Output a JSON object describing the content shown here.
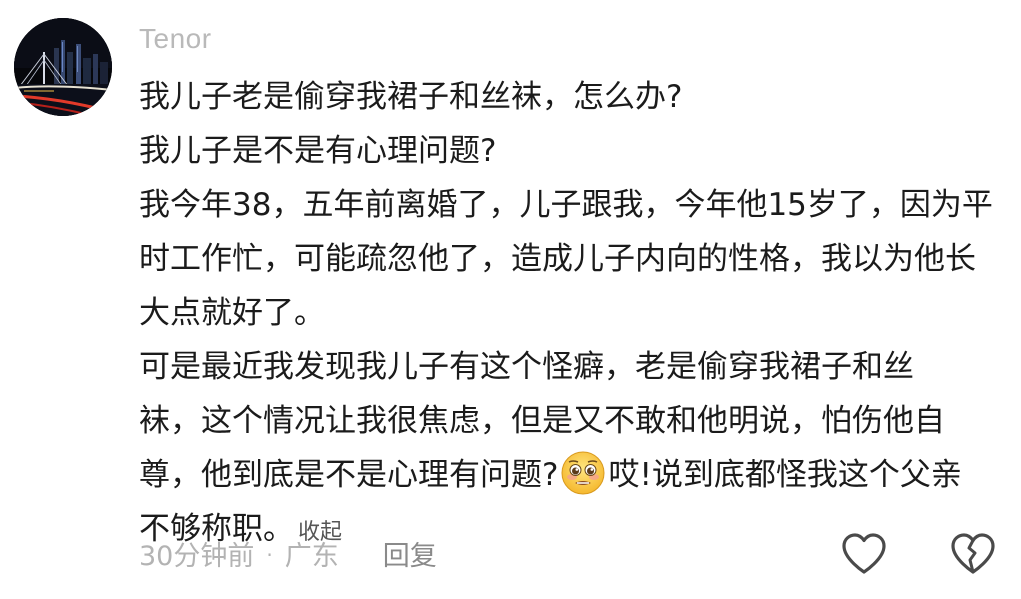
{
  "comment": {
    "username": "Tenor",
    "avatar_icon": "city-night-avatar",
    "lines": [
      "我儿子老是偷穿我裙子和丝袜，怎么办?",
      "我儿子是不是有心理问题?",
      "我今年38，五年前离婚了，儿子跟我，今年他15岁了，因为平",
      "时工作忙，可能疏忽他了，造成儿子内向的性格，我以为他长",
      "大点就好了。",
      "可是最近我发现我儿子有这个怪癖，老是偷穿我裙子和丝",
      "袜，这个情况让我很焦虑，但是又不敢和他明说，怕伤他自"
    ],
    "line8_before_emoji": "尊，他到底是不是心理有问题?",
    "emoji_icon": "pleading-face-emoji",
    "line8_after_emoji": "哎!说到底都怪我这个父亲",
    "line9": "不够称职。",
    "collapse_label": "收起",
    "meta": {
      "time": "30分钟前",
      "separator": "·",
      "location": "广东",
      "reply_label": "回复"
    },
    "actions": {
      "like_icon": "heart-outline-icon",
      "dislike_icon": "broken-heart-outline-icon"
    }
  },
  "colors": {
    "text": "#1b1b1b",
    "muted": "#b3b3b3",
    "icon": "#4a4a4a"
  }
}
